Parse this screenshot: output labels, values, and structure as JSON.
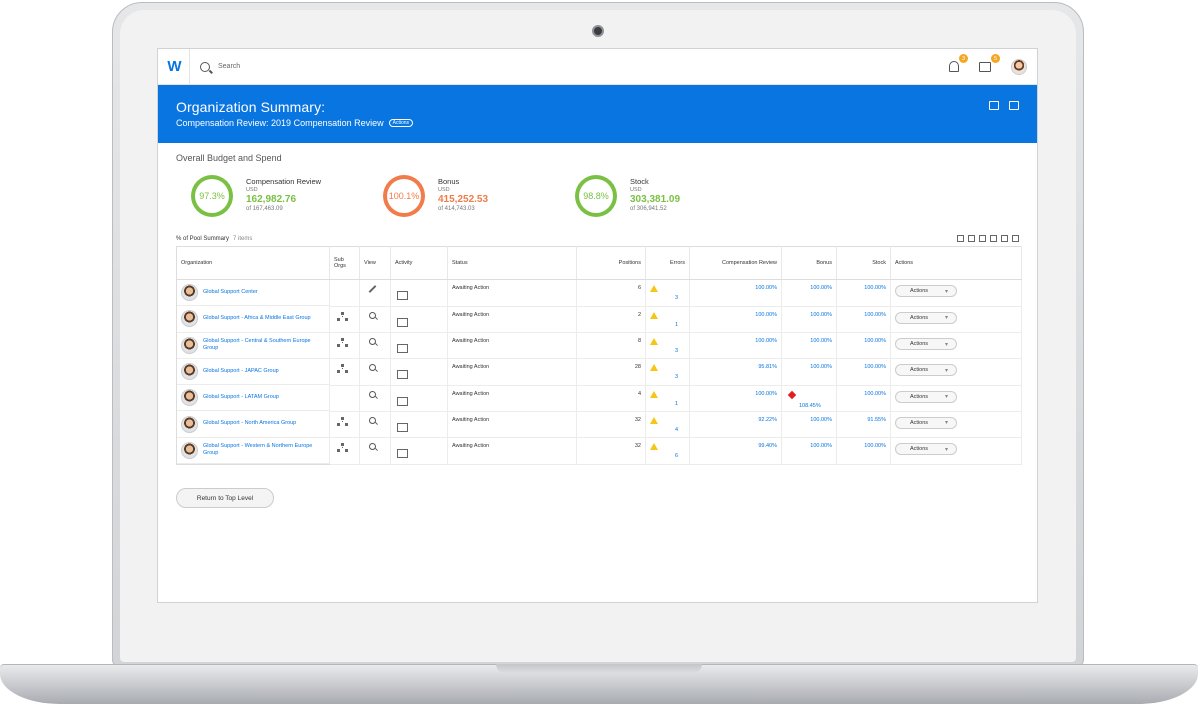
{
  "topbar": {
    "logo_letter": "W",
    "search_placeholder": "Search",
    "notifications_count": "3",
    "inbox_count": "5"
  },
  "header": {
    "title": "Organization Summary:",
    "subtitle": "Compensation Review: 2019 Compensation Review",
    "actions_label": "Actions"
  },
  "budget": {
    "title": "Overall Budget and Spend",
    "cards": [
      {
        "name": "Compensation Review",
        "currency": "USD",
        "amount": "162,982.76",
        "of": "of 167,463.09",
        "percent": "97.3%",
        "color": "green",
        "pct_value": 97.3
      },
      {
        "name": "Bonus",
        "currency": "USD",
        "amount": "415,252.53",
        "of": "of 414,743.03",
        "percent": "100.1%",
        "color": "orange",
        "pct_value": 100.1
      },
      {
        "name": "Stock",
        "currency": "USD",
        "amount": "303,381.09",
        "of": "of 306,941.52",
        "percent": "98.8%",
        "color": "green",
        "pct_value": 98.8
      }
    ]
  },
  "pool": {
    "title": "% of Pool Summary",
    "count": "7 items",
    "columns": [
      "Organization",
      "Sub Orgs",
      "View",
      "Activity",
      "Status",
      "Positions",
      "Errors",
      "Compensation Review",
      "Bonus",
      "Stock",
      "Actions"
    ],
    "rows": [
      {
        "org": "Global Support Center",
        "sub": false,
        "view": "edit",
        "status": "Awaiting Action",
        "positions": "6",
        "errors": "3",
        "error_type": "warning",
        "comp": "100.00%",
        "bonus": "100.00%",
        "bonus_flag": false,
        "stock": "100.00%",
        "action": "Actions"
      },
      {
        "org": "Global Support - Africa & Middle East Group",
        "sub": true,
        "view": "search",
        "status": "Awaiting Action",
        "positions": "2",
        "errors": "1",
        "error_type": "warning",
        "comp": "100.00%",
        "bonus": "100.00%",
        "bonus_flag": false,
        "stock": "100.00%",
        "action": "Actions"
      },
      {
        "org": "Global Support - Central & Southern Europe Group",
        "sub": true,
        "view": "search",
        "status": "Awaiting Action",
        "positions": "8",
        "errors": "3",
        "error_type": "warning",
        "comp": "100.00%",
        "bonus": "100.00%",
        "bonus_flag": false,
        "stock": "100.00%",
        "action": "Actions"
      },
      {
        "org": "Global Support - JAPAC Group",
        "sub": true,
        "view": "search",
        "status": "Awaiting Action",
        "positions": "28",
        "errors": "3",
        "error_type": "warning",
        "comp": "95.81%",
        "bonus": "100.00%",
        "bonus_flag": false,
        "stock": "100.00%",
        "action": "Actions"
      },
      {
        "org": "Global Support - LATAM Group",
        "sub": false,
        "view": "search",
        "status": "Awaiting Action",
        "positions": "4",
        "errors": "1",
        "error_type": "warning",
        "comp": "100.00%",
        "bonus": "108.45%",
        "bonus_flag": true,
        "stock": "100.00%",
        "action": "Actions"
      },
      {
        "org": "Global Support - North America Group",
        "sub": true,
        "view": "search",
        "status": "Awaiting Action",
        "positions": "32",
        "errors": "4",
        "error_type": "warning",
        "comp": "92.22%",
        "bonus": "100.00%",
        "bonus_flag": false,
        "stock": "91.55%",
        "action": "Actions"
      },
      {
        "org": "Global Support - Western & Northern Europe Group",
        "sub": true,
        "view": "search",
        "status": "Awaiting Action",
        "positions": "32",
        "errors": "6",
        "error_type": "warning",
        "comp": "99.40%",
        "bonus": "100.00%",
        "bonus_flag": false,
        "stock": "100.00%",
        "action": "Actions"
      }
    ]
  },
  "return_button": "Return to Top Level",
  "colors": {
    "brand_blue": "#0875e1",
    "green": "#7ac143",
    "orange": "#f07c4a",
    "warning": "#f5c518",
    "error": "#e02020"
  }
}
